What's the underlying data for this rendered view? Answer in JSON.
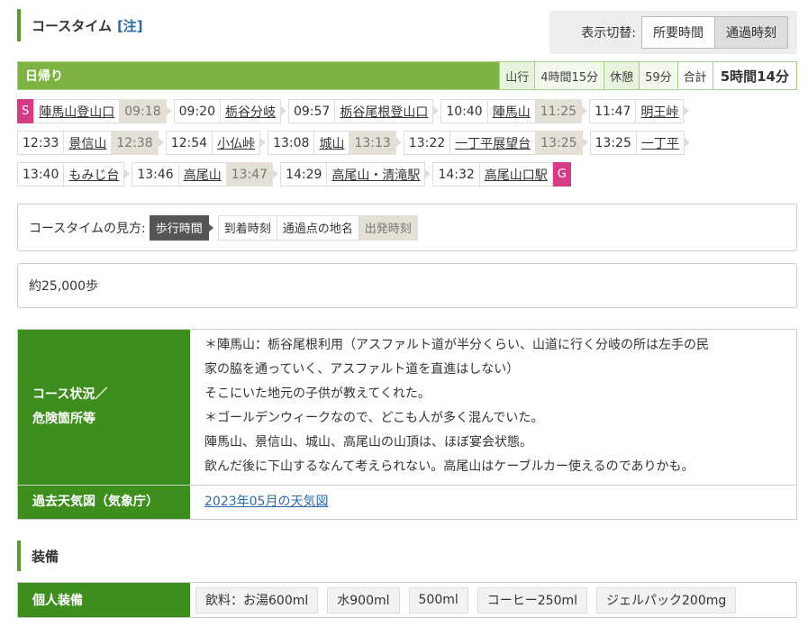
{
  "header": {
    "title": "コースタイム",
    "note": "[注]"
  },
  "toggle": {
    "label": "表示切替:",
    "options": [
      "所要時間",
      "通過時刻"
    ]
  },
  "summary": {
    "title": "日帰り",
    "walk_label": "山行",
    "walk_value": "4時間15分",
    "rest_label": "休憩",
    "rest_value": "59分",
    "total_label": "合計",
    "total_value": "5時間14分"
  },
  "route": {
    "start_badge": "S",
    "goal_badge": "G",
    "rows": [
      [
        {
          "arr": "",
          "name": "陣馬山登山口",
          "dep": "09:18"
        },
        {
          "arr": "09:20",
          "name": "栃谷分岐",
          "dep": ""
        },
        {
          "arr": "09:57",
          "name": "栃谷尾根登山口",
          "dep": ""
        },
        {
          "arr": "10:40",
          "name": "陣馬山",
          "dep": "11:25"
        },
        {
          "arr": "11:47",
          "name": "明王峠",
          "dep": ""
        }
      ],
      [
        {
          "arr": "12:33",
          "name": "景信山",
          "dep": "12:38"
        },
        {
          "arr": "12:54",
          "name": "小仏峠",
          "dep": ""
        },
        {
          "arr": "13:08",
          "name": "城山",
          "dep": "13:13"
        },
        {
          "arr": "13:22",
          "name": "一丁平展望台",
          "dep": "13:25"
        },
        {
          "arr": "13:25",
          "name": "一丁平",
          "dep": ""
        }
      ],
      [
        {
          "arr": "13:40",
          "name": "もみじ台",
          "dep": ""
        },
        {
          "arr": "13:46",
          "name": "高尾山",
          "dep": "13:47"
        },
        {
          "arr": "14:29",
          "name": "高尾山・清滝駅",
          "dep": ""
        },
        {
          "arr": "14:32",
          "name": "高尾山口駅",
          "dep": ""
        }
      ]
    ]
  },
  "legend": {
    "label": "コースタイムの見方:",
    "walk": "歩行時間",
    "arrive": "到着時刻",
    "place": "通過点の地名",
    "depart": "出発時刻"
  },
  "steps": "約25,000歩",
  "conditions": {
    "label_line1": "コース状況／",
    "label_line2": "危険箇所等",
    "lines": [
      "＊陣馬山：栃谷尾根利用（アスファルト道が半分くらい、山道に行く分岐の所は左手の民",
      "家の脇を通っていく、アスファルト道を直進はしない）",
      "そこにいた地元の子供が教えてくれた。",
      "＊ゴールデンウィークなので、どこも人が多く混んでいた。",
      "陣馬山、景信山、城山、高尾山の山頂は、ほぼ宴会状態。",
      "飲んだ後に下山するなんて考えられない。高尾山はケーブルカー使えるのでありかも。"
    ],
    "weather_label": "過去天気図（気象庁）",
    "weather_link": "2023年05月の天気図"
  },
  "equipment": {
    "heading": "装備",
    "personal_label": "個人装備",
    "items": [
      "飲料：お湯600ml",
      "水900ml",
      "500ml",
      "コーヒー250ml",
      "ジェルパック200mg"
    ]
  }
}
